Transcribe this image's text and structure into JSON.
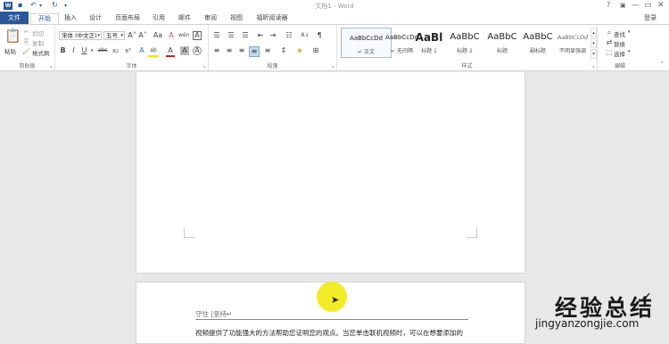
{
  "titlebar": {
    "title": "文档1 - Word",
    "help": "?",
    "minimize": "—",
    "restore": "▭",
    "close": "✕",
    "undo": "↶",
    "redo": "↻",
    "customize": "▾"
  },
  "tabs": [
    {
      "label": "文件"
    },
    {
      "label": "开始"
    },
    {
      "label": "插入"
    },
    {
      "label": "设计"
    },
    {
      "label": "页面布局"
    },
    {
      "label": "引用"
    },
    {
      "label": "邮件"
    },
    {
      "label": "审阅"
    },
    {
      "label": "视图"
    },
    {
      "label": "福昕阅读器"
    }
  ],
  "signin": "登录",
  "clipboard": {
    "paste": "粘贴",
    "cut": "剪切",
    "copy": "复制",
    "format_painter": "格式刷",
    "group": "剪贴板"
  },
  "font": {
    "name": "宋体 (中文正)",
    "size": "五号",
    "grow": "A˄",
    "shrink": "A˅",
    "case": "Aa",
    "clear": "A",
    "phonetic": "wén",
    "charborder": "A",
    "bold": "B",
    "italic": "I",
    "underline": "U",
    "strike": "abc",
    "sub": "x₂",
    "sup": "x²",
    "effects": "A",
    "highlight": "ab",
    "color": "A",
    "shade": "A",
    "charframe": "A",
    "group": "字体"
  },
  "paragraph": {
    "group": "段落",
    "show_marks": "¶",
    "sort": "A↓"
  },
  "styles": {
    "group": "样式",
    "items": [
      {
        "sample": "AaBbCcDd",
        "name": "↵ 正文"
      },
      {
        "sample": "AaBbCcDd",
        "name": "↵ 无间隔"
      },
      {
        "sample": "AaBl",
        "name": "标题 1"
      },
      {
        "sample": "AaBbC",
        "name": "标题 2"
      },
      {
        "sample": "AaBbC",
        "name": "标题"
      },
      {
        "sample": "AaBbC",
        "name": "副标题"
      },
      {
        "sample": "AaBbCcDd",
        "name": "不明显强调"
      }
    ]
  },
  "editing": {
    "find": "查找",
    "replace": "替换",
    "select": "选择",
    "group": "编辑"
  },
  "document": {
    "header_text": "守住 |坚持↵",
    "body_text": "视频提供了功能强大的方法帮助您证明您的观点。当您单击联机视频时，可以在想要添加的"
  },
  "watermark": {
    "brand": "经验总结",
    "url": "jingyanzongjie.com"
  }
}
